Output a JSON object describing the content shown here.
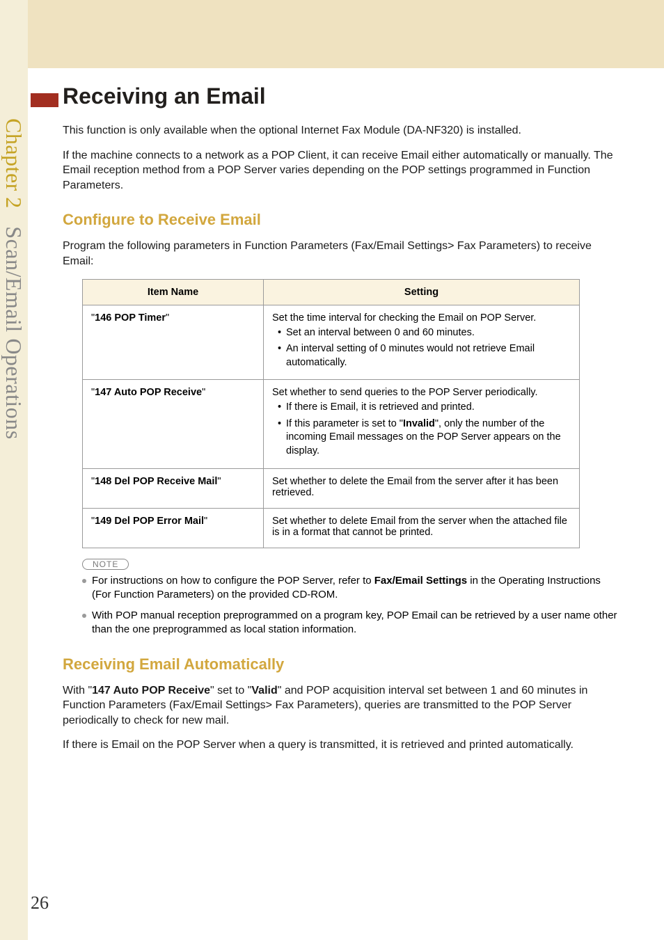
{
  "sidebar": {
    "chapter": "Chapter 2",
    "title": "Scan/Email Operations"
  },
  "page": {
    "number": "26"
  },
  "main": {
    "heading": "Receiving an Email",
    "intro1": "This function is only available when the optional Internet Fax Module (DA-NF320) is installed.",
    "intro2": "If the machine connects to a network as a POP Client, it can receive Email either automatically or manually. The Email reception method from a POP Server varies depending on the POP settings programmed in Function Parameters.",
    "section1": {
      "heading": "Configure to Receive Email",
      "intro": "Program the following parameters in Function Parameters (Fax/Email Settings> Fax Parameters) to receive Email:",
      "table": {
        "headers": {
          "col1": "Item Name",
          "col2": "Setting"
        },
        "rows": [
          {
            "item": "146 POP Timer",
            "desc": "Set the time interval for checking the Email on POP Server.",
            "bullets": [
              "Set an interval between 0 and 60 minutes.",
              "An interval setting of 0 minutes would not retrieve Email automatically."
            ]
          },
          {
            "item": "147 Auto POP Receive",
            "desc": "Set whether to send queries to the POP Server periodically.",
            "bullets": [
              "If there is Email, it is retrieved and printed.",
              "If this parameter is set to \"__BOLD__Invalid__END__\", only the number of the incoming Email messages on the POP Server appears on the display."
            ]
          },
          {
            "item": "148 Del POP Receive Mail",
            "desc": "Set whether to delete the Email from the server after it has been retrieved.",
            "bullets": []
          },
          {
            "item": "149 Del POP Error Mail",
            "desc": "Set whether to delete Email from the server when the attached file is in a format that cannot be printed.",
            "bullets": []
          }
        ]
      },
      "note_label": "NOTE",
      "notes": [
        "For instructions on how to configure the POP Server, refer to __BOLD__Fax/Email Settings__END__ in the Operating Instructions (For Function Parameters) on the provided CD-ROM.",
        "With POP manual reception preprogrammed on a program key, POP Email can be retrieved by a user name other than the one preprogrammed as local station information."
      ]
    },
    "section2": {
      "heading": "Receiving Email Automatically",
      "p1": "With \"__BOLD__147 Auto POP Receive__END__\" set to \"__BOLD__Valid__END__\" and POP acquisition interval set between 1 and 60 minutes in Function Parameters (Fax/Email Settings> Fax Parameters), queries are transmitted to the POP Server periodically to check for new mail.",
      "p2": "If there is Email on the POP Server when a query is transmitted, it is retrieved and printed automatically."
    }
  }
}
